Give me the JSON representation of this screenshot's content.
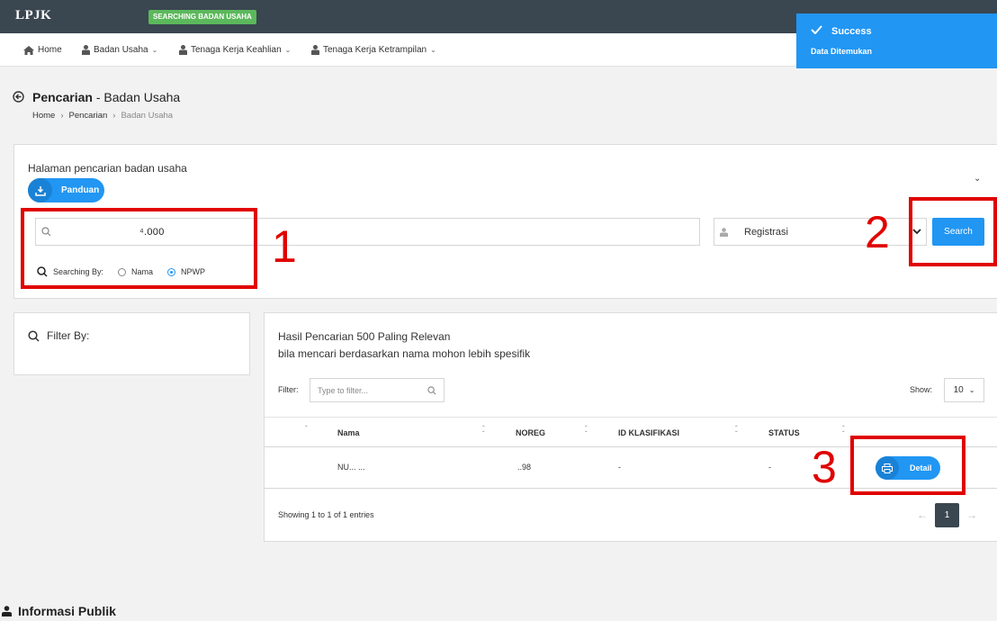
{
  "app": {
    "brand": "LPJK",
    "status_chip": "SEARCHING BADAN USAHA"
  },
  "nav": {
    "items": [
      {
        "label": "Home",
        "icon": "home-icon"
      },
      {
        "label": "Badan Usaha",
        "icon": "user-tie-icon"
      },
      {
        "label": "Tenaga Kerja Keahlian",
        "icon": "user-tie-icon"
      },
      {
        "label": "Tenaga Kerja Ketrampilan",
        "icon": "user-tie-icon"
      }
    ]
  },
  "toast": {
    "title": "Success",
    "message": "Data Ditemukan",
    "color": "#2196f3"
  },
  "page": {
    "title_bold": "Pencarian",
    "title_rest": " - Badan Usaha",
    "breadcrumb": [
      "Home",
      "Pencarian",
      "Badan Usaha"
    ]
  },
  "search": {
    "caption": "Halaman pencarian badan usaha",
    "guide_button": "Panduan",
    "query_value": "⁴.000",
    "searching_by_label": "Searching By:",
    "options": [
      "Nama",
      "NPWP"
    ],
    "selected_option": "NPWP",
    "type_value": "Registrasi",
    "search_button": "Search"
  },
  "filter": {
    "title": "Filter By:"
  },
  "results": {
    "heading_line1": "Hasil Pencarian 500 Paling Relevan",
    "heading_line2": "bila mencari berdasarkan nama mohon lebih spesifik",
    "filter_label": "Filter:",
    "filter_placeholder": "Type to filter...",
    "show_label": "Show:",
    "show_value": "10",
    "columns": [
      "Nama",
      "NOREG",
      "ID KLASIFIKASI",
      "STATUS"
    ],
    "rows": [
      {
        "nama": "NU... ...",
        "noreg": "..98",
        "id_klasifikasi": "-",
        "status": "-",
        "action": "Detail"
      }
    ],
    "entries_text": "Showing 1 to 1 of 1 entries",
    "pagination": {
      "prev": "←",
      "current": "1",
      "next": "→"
    }
  },
  "footer": {
    "info_publik": "Informasi Publik"
  },
  "annotations": [
    "1",
    "2",
    "3"
  ],
  "colors": {
    "accent": "#2196f3",
    "topbar": "#3a4650",
    "chip": "#5cb85c",
    "annotation": "#e00000"
  }
}
